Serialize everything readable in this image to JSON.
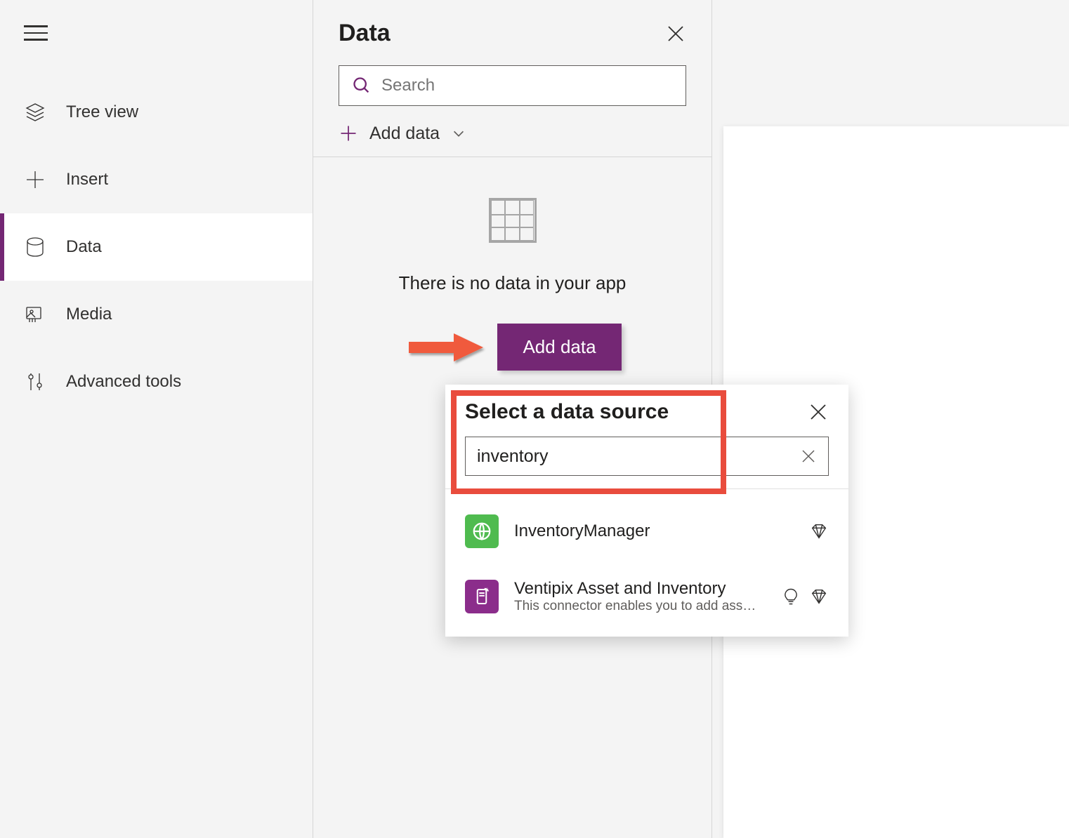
{
  "sidebar": {
    "items": [
      {
        "label": "Tree view",
        "icon": "layers"
      },
      {
        "label": "Insert",
        "icon": "plus"
      },
      {
        "label": "Data",
        "icon": "database",
        "active": true
      },
      {
        "label": "Media",
        "icon": "media"
      },
      {
        "label": "Advanced tools",
        "icon": "tools"
      }
    ]
  },
  "panel": {
    "title": "Data",
    "search_placeholder": "Search",
    "add_data_label": "Add data",
    "empty_message": "There is no data in your app",
    "add_data_button": "Add data"
  },
  "popup": {
    "title": "Select a data source",
    "search_value": "inventory",
    "items": [
      {
        "name": "InventoryManager",
        "desc": "",
        "color": "#4fbb4f",
        "badges": [
          "premium"
        ]
      },
      {
        "name": "Ventipix Asset and Inventory",
        "desc": "This connector enables you to add ass…",
        "color": "#8b2d8b",
        "badges": [
          "idea",
          "premium"
        ]
      }
    ]
  }
}
